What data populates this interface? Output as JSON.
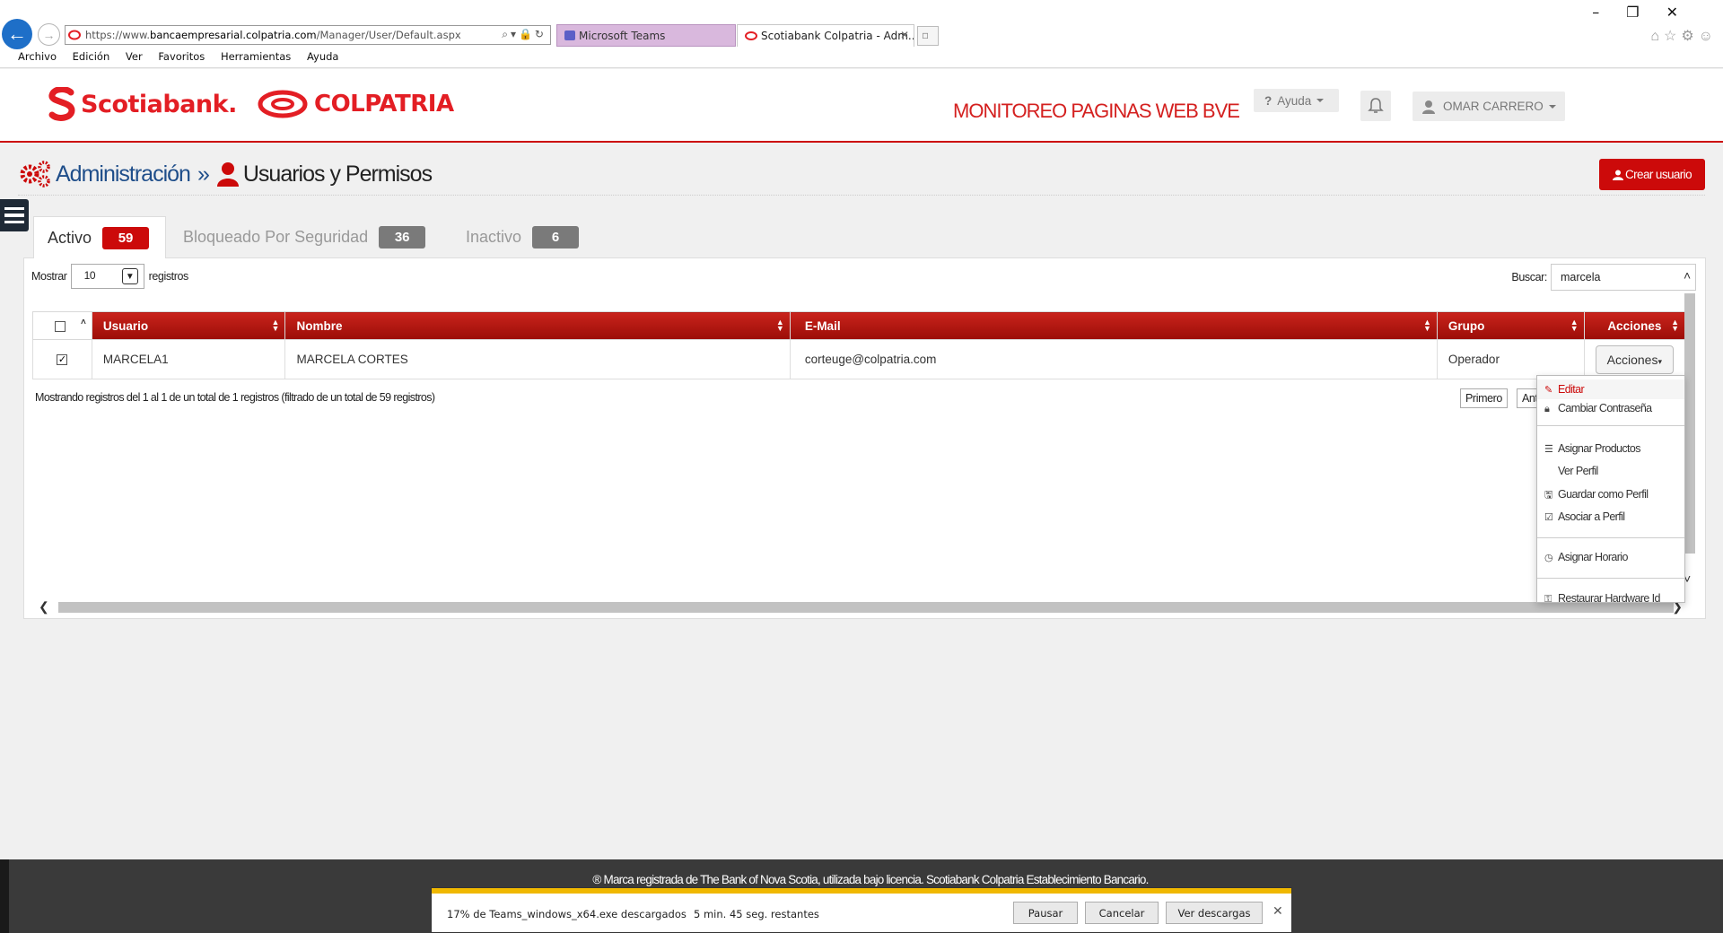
{
  "browser": {
    "url_prefix": "https://www.",
    "url_domain": "bancaempresarial.colpatria.com",
    "url_path": "/Manager/User/Default.aspx",
    "tabs": [
      {
        "label": "Microsoft Teams"
      },
      {
        "label": "Scotiabank Colpatria - Adm..."
      }
    ],
    "menu": [
      "Archivo",
      "Edición",
      "Ver",
      "Favoritos",
      "Herramientas",
      "Ayuda"
    ]
  },
  "header": {
    "brand_scotia": "Scotiabank.",
    "brand_colpatria": "COLPATRIA",
    "site_title": "MONITOREO PAGINAS WEB BVE",
    "help_label": "Ayuda",
    "user_label": "OMAR CARRERO",
    "brand_color": "#e31e24"
  },
  "breadcrumb": {
    "admin": "Administración",
    "separator": "»",
    "current": "Usuarios y Permisos"
  },
  "create_button": "Crear usuario",
  "status_tabs": [
    {
      "label": "Activo",
      "count": "59"
    },
    {
      "label": "Bloqueado Por Seguridad",
      "count": "36"
    },
    {
      "label": "Inactivo",
      "count": "6"
    }
  ],
  "table_controls": {
    "show_label": "Mostrar",
    "show_value": "10",
    "records_label": "registros",
    "search_label": "Buscar:",
    "search_value": "marcela"
  },
  "table": {
    "headers": [
      "Usuario",
      "Nombre",
      "E-Mail",
      "Grupo",
      "Acciones"
    ],
    "rows": [
      {
        "usuario": "MARCELA1",
        "nombre": "MARCELA CORTES",
        "email": "corteuge@colpatria.com",
        "grupo": "Operador",
        "acciones": "Acciones",
        "checked": true
      }
    ]
  },
  "info_text": "Mostrando registros del 1 al 1 de un total de 1 registros (filtrado de un total de 59 registros)",
  "pager": {
    "first": "Primero",
    "prev": "Anterior"
  },
  "actions_menu": [
    {
      "label": "Editar",
      "icon": "edit-icon"
    },
    {
      "label": "Cambiar Contraseña",
      "icon": "lock-icon"
    },
    {
      "label": "Asignar Productos",
      "icon": "list-icon"
    },
    {
      "label": "Ver Perfil",
      "icon": ""
    },
    {
      "label": "Guardar como Perfil",
      "icon": "save-icon"
    },
    {
      "label": "Asociar a Perfil",
      "icon": "check-square-icon"
    },
    {
      "label": "Asignar Horario",
      "icon": "clock-icon"
    },
    {
      "label": "Restaurar Hardware Id",
      "icon": "key-icon"
    }
  ],
  "footer": "® Marca registrada de The Bank of Nova Scotia, utilizada bajo licencia. Scotiabank Colpatria Establecimiento Bancario.",
  "download": {
    "progress_percent": 17,
    "file_text": "17% de Teams_windows_x64.exe descargados",
    "remaining": "5 min. 45 seg. restantes",
    "pause": "Pausar",
    "cancel": "Cancelar",
    "view": "Ver descargas"
  }
}
